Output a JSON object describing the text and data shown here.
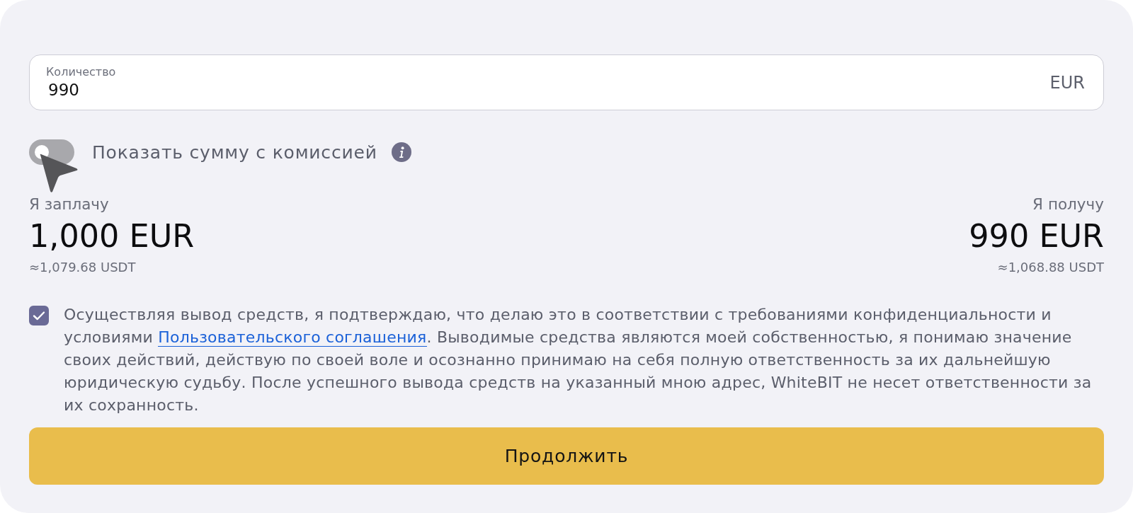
{
  "amount_field": {
    "label": "Количество",
    "value": "990",
    "currency": "EUR"
  },
  "fee_toggle": {
    "label": "Показать сумму с комиссией",
    "on": false
  },
  "pay": {
    "label": "Я заплачу",
    "amount": "1,000 EUR",
    "equivalent": "≈1,079.68 USDT"
  },
  "receive": {
    "label": "Я получу",
    "amount": "990 EUR",
    "equivalent": "≈1,068.88 USDT"
  },
  "agreement": {
    "checked": true,
    "text_before": "Осуществляя вывод средств, я подтверждаю, что делаю это в соответствии с требованиями конфиденциальности и условиями ",
    "link": "Пользовательского соглашения",
    "text_after": ". Выводимые средства являются моей собственностью, я понимаю значение своих действий, действую по своей воле и осознанно принимаю на себя полную ответственность за их дальнейшую юридическую судьбу. После успешного вывода средств на указанный мною адрес, WhiteBIT не несет ответственности за их сохранность."
  },
  "continue_button": {
    "label": "Продолжить"
  }
}
